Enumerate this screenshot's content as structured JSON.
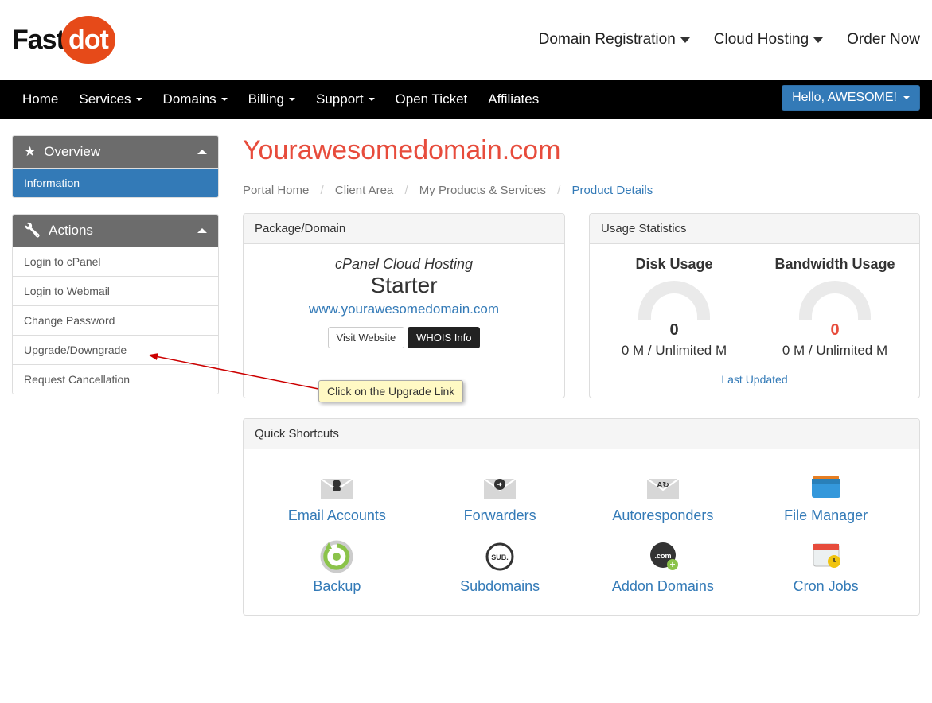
{
  "logo": {
    "part1": "Fast",
    "part2": "dot"
  },
  "topNav": {
    "domain_reg": "Domain Registration",
    "cloud_hosting": "Cloud Hosting",
    "order_now": "Order Now"
  },
  "navbar": {
    "home": "Home",
    "services": "Services",
    "domains": "Domains",
    "billing": "Billing",
    "support": "Support",
    "open_ticket": "Open Ticket",
    "affiliates": "Affiliates",
    "user_greeting": "Hello, AWESOME!"
  },
  "sidebar": {
    "overview_title": "Overview",
    "overview_items": {
      "information": "Information"
    },
    "actions_title": "Actions",
    "actions_items": {
      "login_cpanel": "Login to cPanel",
      "login_webmail": "Login to Webmail",
      "change_password": "Change Password",
      "upgrade_downgrade": "Upgrade/Downgrade",
      "request_cancellation": "Request Cancellation"
    }
  },
  "page": {
    "title": "Yourawesomedomain.com"
  },
  "breadcrumb": {
    "portal_home": "Portal Home",
    "client_area": "Client Area",
    "products": "My Products & Services",
    "details": "Product Details"
  },
  "package": {
    "header": "Package/Domain",
    "type": "cPanel Cloud Hosting",
    "name": "Starter",
    "domain": "www.yourawesomedomain.com",
    "visit": "Visit Website",
    "whois": "WHOIS Info"
  },
  "usage": {
    "header": "Usage Statistics",
    "disk_title": "Disk Usage",
    "bw_title": "Bandwidth Usage",
    "disk_value": "0",
    "bw_value": "0",
    "disk_text": "0 M / Unlimited M",
    "bw_text": "0 M / Unlimited M",
    "last_updated": "Last Updated"
  },
  "shortcuts": {
    "header": "Quick Shortcuts",
    "email": "Email Accounts",
    "forwarders": "Forwarders",
    "autoresponders": "Autoresponders",
    "filemanager": "File Manager",
    "backup": "Backup",
    "subdomains": "Subdomains",
    "addon": "Addon Domains",
    "cron": "Cron Jobs"
  },
  "callout": {
    "text": "Click on the Upgrade Link"
  }
}
